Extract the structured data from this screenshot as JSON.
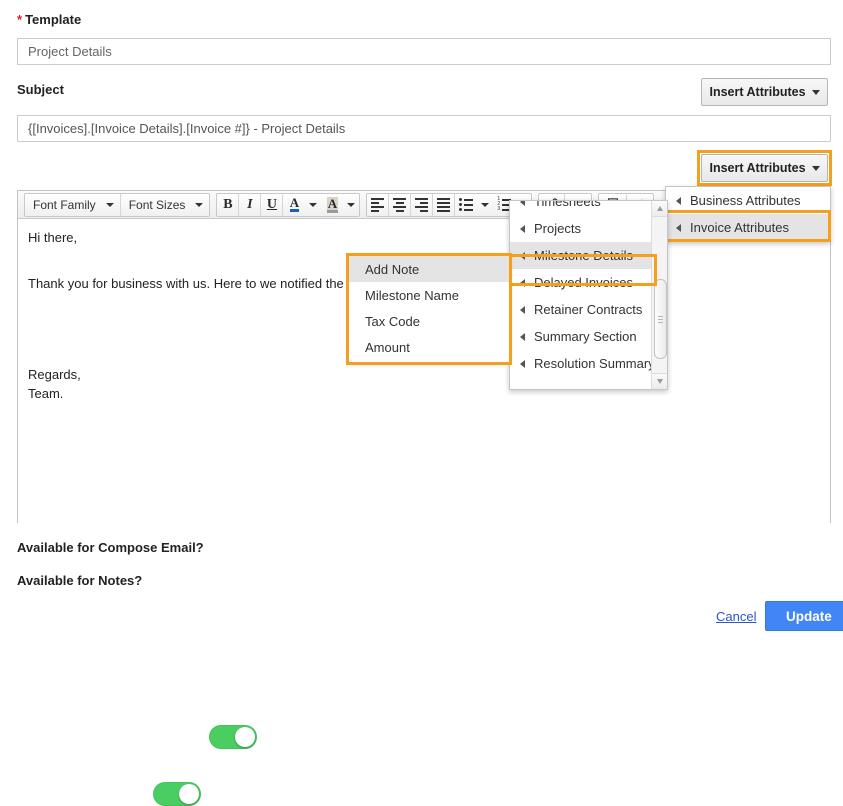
{
  "form": {
    "template_label": "Template",
    "template_required_mark": "*",
    "template_value": "Project Details",
    "subject_label": "Subject",
    "subject_value": "{[Invoices].[Invoice Details].[Invoice #]}  - Project Details"
  },
  "insert_attributes": {
    "top_label": "Insert Attributes",
    "main_label": "Insert Attributes"
  },
  "editor": {
    "toolbar": {
      "font_family": "Font Family",
      "font_sizes": "Font Sizes",
      "bold": "B",
      "italic": "I",
      "underline": "U",
      "text_color": "A",
      "background_color": "A"
    },
    "body": {
      "greeting": "Hi there,",
      "paragraph": "Thank you for business with us. Here to we notified the statu",
      "closing": "Regards,",
      "signature": "Team."
    }
  },
  "menu_level1": {
    "items": [
      {
        "label": "Business Attributes",
        "hover": false
      },
      {
        "label": "Invoice Attributes",
        "hover": true
      }
    ]
  },
  "menu_level2": {
    "items": [
      {
        "label": "Timesheets",
        "hover": false
      },
      {
        "label": "Projects",
        "hover": false
      },
      {
        "label": "Milestone Details",
        "hover": true
      },
      {
        "label": "Delayed Invoices",
        "hover": false
      },
      {
        "label": "Retainer Contracts",
        "hover": false
      },
      {
        "label": "Summary Section",
        "hover": false
      },
      {
        "label": "Resolution Summary",
        "hover": false
      }
    ]
  },
  "menu_level3": {
    "items": [
      {
        "label": "Add Note",
        "hover": true
      },
      {
        "label": "Milestone Name",
        "hover": false
      },
      {
        "label": "Tax Code",
        "hover": false
      },
      {
        "label": "Amount",
        "hover": false
      }
    ]
  },
  "toggles": [
    {
      "label": "Available for Compose Email?",
      "state": "on"
    },
    {
      "label": "Available for Notes?",
      "state": "on"
    }
  ],
  "footer": {
    "cancel_label": "Cancel",
    "update_label": "Update"
  },
  "colors": {
    "highlight_orange": "#f5a01c",
    "toggle_green": "#4ace62",
    "primary_blue": "#4285f4",
    "link_blue": "#2a56c6",
    "required_red": "#e02020"
  }
}
